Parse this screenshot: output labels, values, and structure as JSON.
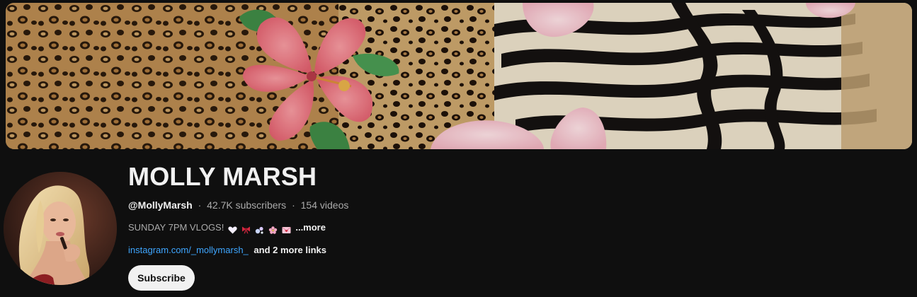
{
  "channel": {
    "name": "MOLLY MARSH",
    "handle": "@MollyMarsh",
    "subscribers": "42.7K subscribers",
    "videos": "154 videos",
    "separator": "·"
  },
  "description": {
    "text": "SUNDAY 7PM VLOGS!",
    "emojis": [
      "white-heart-icon",
      "ribbon-icon",
      "bubbles-icon",
      "cherry-blossom-icon",
      "love-letter-icon"
    ],
    "more_label": "...more"
  },
  "links": {
    "primary": "instagram.com/_mollymarsh_",
    "more": "and 2 more links"
  },
  "actions": {
    "subscribe_label": "Subscribe"
  },
  "colors": {
    "background": "#0f0f0f",
    "link": "#3ea6ff",
    "button_bg": "#f1f1f1",
    "secondary_text": "#aaaaaa"
  }
}
